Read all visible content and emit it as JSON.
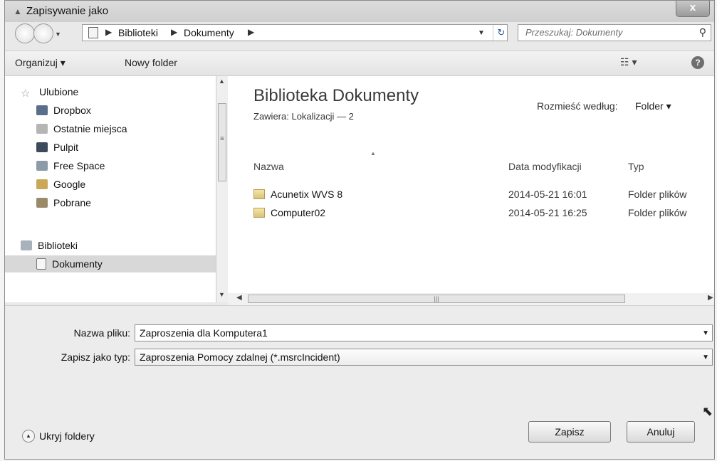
{
  "window": {
    "title": "Zapisywanie jako",
    "close_label": "x"
  },
  "address": {
    "crumbs": [
      "Biblioteki",
      "Dokumenty"
    ],
    "search_placeholder": "Przeszukaj: Dokumenty"
  },
  "toolbar": {
    "organize_label": "Organizuj ▾",
    "new_folder_label": "Nowy folder"
  },
  "nav": {
    "favorites_label": "Ulubione",
    "favorites": [
      "Dropbox",
      "Ostatnie miejsca",
      "Pulpit",
      "Free Space",
      "Google",
      "Pobrane"
    ],
    "libraries_label": "Biblioteki",
    "selected_item": "Dokumenty"
  },
  "content": {
    "title": "Biblioteka Dokumenty",
    "subtitle": "Zawiera: Lokalizacji — 2",
    "arrange_label": "Rozmieść według:",
    "arrange_value": "Folder ▾",
    "columns": [
      "Nazwa",
      "Data modyfikacji",
      "Typ"
    ],
    "files": [
      {
        "name": "Acunetix WVS 8",
        "date": "2014-05-21 16:01",
        "type": "Folder plików"
      },
      {
        "name": "Computer02",
        "date": "2014-05-21 16:25",
        "type": "Folder plików"
      }
    ]
  },
  "form": {
    "filename_label": "Nazwa pliku:",
    "filename_value": "Zaproszenia dla Komputera1",
    "filetype_label": "Zapisz jako typ:",
    "filetype_value": "Zaproszenia Pomocy zdalnej (*.msrcIncident)"
  },
  "footer": {
    "hide_folders_label": "Ukryj foldery",
    "save_label": "Zapisz",
    "cancel_label": "Anuluj"
  }
}
